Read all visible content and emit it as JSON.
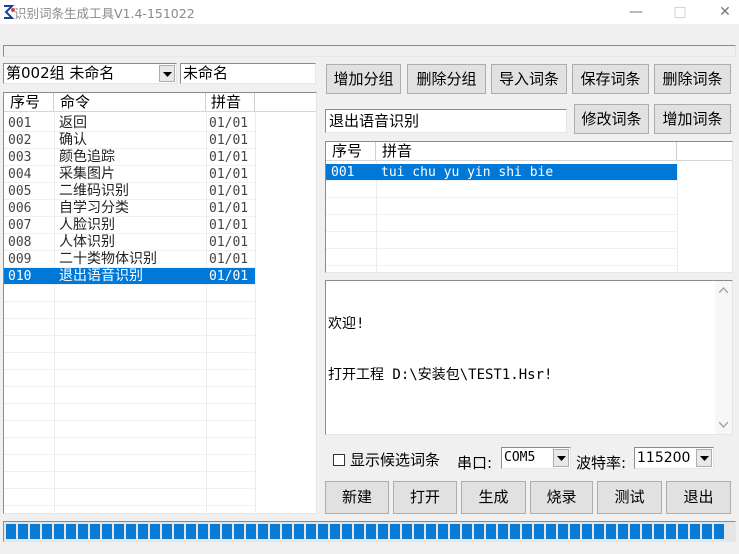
{
  "window": {
    "title": "识别词条生成工具V1.4-151022",
    "minimize_glyph": "—",
    "maximize_glyph": "□",
    "close_glyph": "✕"
  },
  "group": {
    "selected": "第002组 未命名",
    "name_value": "未命名"
  },
  "left_table": {
    "headers": [
      "序号",
      "命令",
      "拼音"
    ],
    "rows": [
      {
        "index": "001",
        "command": "返回",
        "pinyin": "01/01"
      },
      {
        "index": "002",
        "command": "确认",
        "pinyin": "01/01"
      },
      {
        "index": "003",
        "command": "颜色追踪",
        "pinyin": "01/01"
      },
      {
        "index": "004",
        "command": "采集图片",
        "pinyin": "01/01"
      },
      {
        "index": "005",
        "command": "二维码识别",
        "pinyin": "01/01"
      },
      {
        "index": "006",
        "command": "自学习分类",
        "pinyin": "01/01"
      },
      {
        "index": "007",
        "command": "人脸识别",
        "pinyin": "01/01"
      },
      {
        "index": "008",
        "command": "人体识别",
        "pinyin": "01/01"
      },
      {
        "index": "009",
        "command": "二十类物体识别",
        "pinyin": "01/01"
      },
      {
        "index": "010",
        "command": "退出语音识别",
        "pinyin": "01/01"
      }
    ],
    "selected_index": 9
  },
  "toolbar": {
    "add_group": "增加分组",
    "delete_group": "删除分组",
    "import_entries": "导入词条",
    "save_entries": "保存词条",
    "delete_entry": "删除词条"
  },
  "entry": {
    "value": "退出语音识别",
    "modify_label": "修改词条",
    "add_label": "增加词条"
  },
  "pinyin_table": {
    "headers": [
      "序号",
      "拼音"
    ],
    "rows": [
      {
        "index": "001",
        "pinyin": "tui chu yu yin shi bie"
      }
    ]
  },
  "log": {
    "lines": [
      "欢迎!",
      "打开工程 D:\\安装包\\TEST1.Hsr!"
    ]
  },
  "options": {
    "show_candidates_label": "显示候选词条",
    "show_candidates_checked": false,
    "port_label": "串口:",
    "port_value": "COM5",
    "baud_label": "波特率:",
    "baud_value": "115200"
  },
  "bottom_buttons": {
    "new": "新建",
    "open": "打开",
    "generate": "生成",
    "burn": "烧录",
    "test": "测试",
    "exit": "退出"
  },
  "progress": {
    "fraction": 1.0
  },
  "colors": {
    "accent": "#0078d7",
    "progress": "#0a7bd4"
  }
}
